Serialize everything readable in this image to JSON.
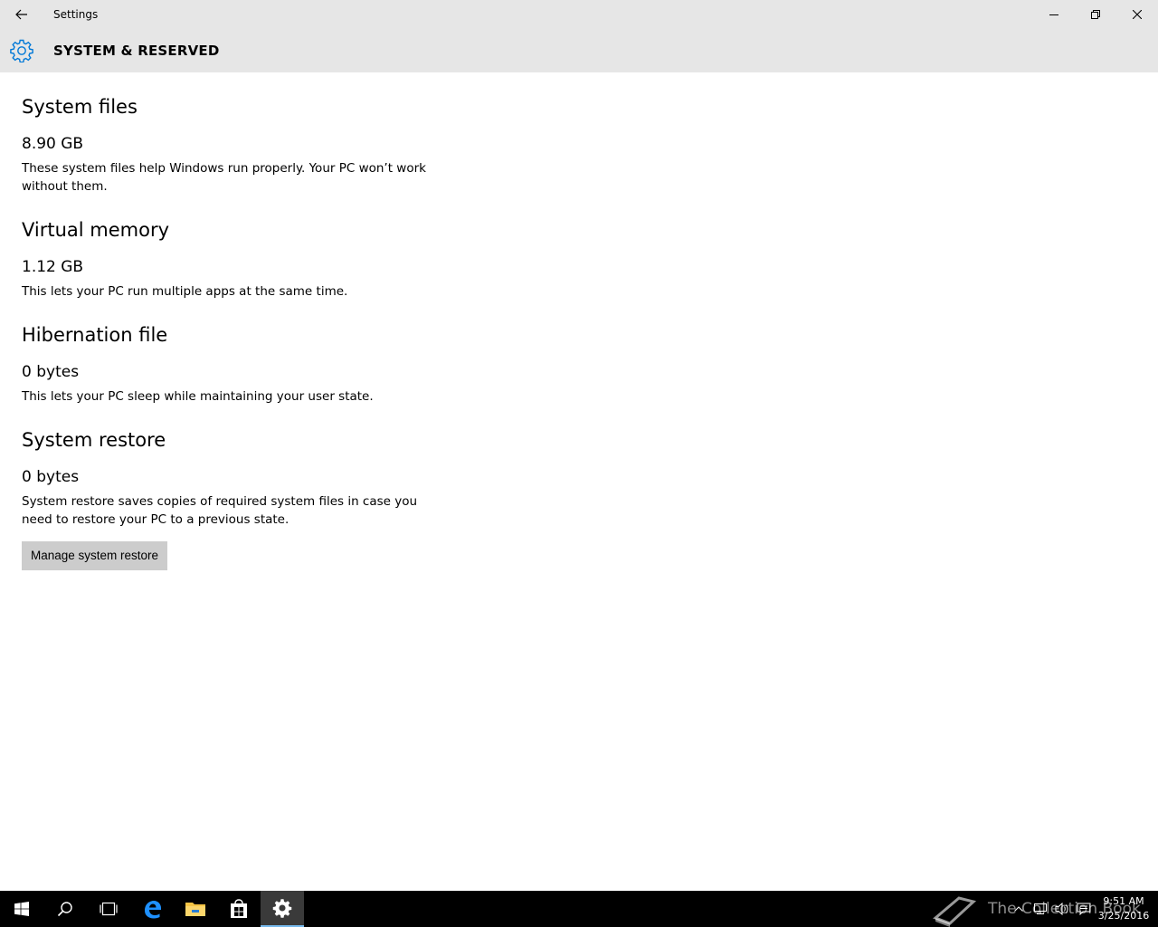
{
  "window": {
    "title": "Settings",
    "back_icon": "back-arrow-icon",
    "minimize_icon": "minimize-icon",
    "restore_icon": "restore-icon",
    "close_icon": "close-icon"
  },
  "header": {
    "icon": "gear-icon",
    "title": "SYSTEM & RESERVED",
    "accent_color": "#0078d7"
  },
  "sections": [
    {
      "heading": "System files",
      "size": "8.90 GB",
      "description": "These system files help Windows run properly. Your PC won’t work without them."
    },
    {
      "heading": "Virtual memory",
      "size": "1.12 GB",
      "description": "This lets your PC run multiple apps at the same time."
    },
    {
      "heading": "Hibernation file",
      "size": "0 bytes",
      "description": "This lets your PC sleep while maintaining your user state."
    },
    {
      "heading": "System restore",
      "size": "0 bytes",
      "description": "System restore saves copies of required system files in case you need to restore your PC to a previous state.",
      "button_label": "Manage system restore"
    }
  ],
  "taskbar": {
    "items": [
      "start-icon",
      "search-icon",
      "task-view-icon",
      "edge-icon",
      "file-explorer-icon",
      "store-icon",
      "settings-icon"
    ],
    "active_item": "settings-icon",
    "clock_time": "9:51 AM",
    "clock_date": "3/25/2016",
    "watermark_text": "The Collection Book",
    "tray_icons": [
      "show-hidden-icons-icon",
      "network-icon",
      "volume-icon",
      "action-center-icon"
    ]
  }
}
